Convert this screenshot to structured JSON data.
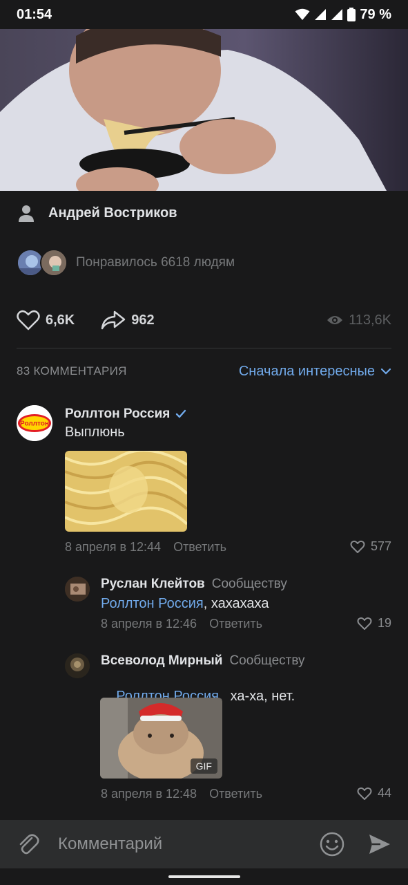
{
  "status": {
    "time": "01:54",
    "battery": "79 %"
  },
  "post": {
    "author": "Андрей Востриков",
    "likers_text": "Понравилось 6618 людям",
    "likes": "6,6K",
    "shares": "962",
    "views": "113,6K"
  },
  "comments_header": {
    "count_label": "83 КОММЕНТАРИЯ",
    "sort_label": "Сначала интересные"
  },
  "comments": [
    {
      "author": "Роллтон Россия",
      "text": "Выплюнь",
      "avatar_text": "Роллтон",
      "date": "8 апреля в 12:44",
      "reply": "Ответить",
      "likes": "577"
    },
    {
      "author": "Руслан Клейтов",
      "to": "Сообществу",
      "mention": "Роллтон Россия",
      "text": ", хахахаха",
      "date": "8 апреля в 12:46",
      "reply": "Ответить",
      "likes": "19"
    },
    {
      "author": "Всеволод Мирный",
      "to": "Сообществу",
      "mention": "Роллтон Россия",
      "text": ",  ха-ха, нет.",
      "gif_badge": "GIF",
      "date": "8 апреля в 12:48",
      "reply": "Ответить",
      "likes": "44"
    }
  ],
  "input": {
    "placeholder": "Комментарий"
  },
  "colors": {
    "background": "#19191a",
    "accent": "#71aaeb",
    "verified": "#71aaeb"
  },
  "icons": [
    "attach-icon",
    "emoji-icon",
    "send-icon",
    "heart-icon",
    "share-icon",
    "eye-icon",
    "user-icon",
    "verified-icon",
    "chevron-down-icon"
  ]
}
